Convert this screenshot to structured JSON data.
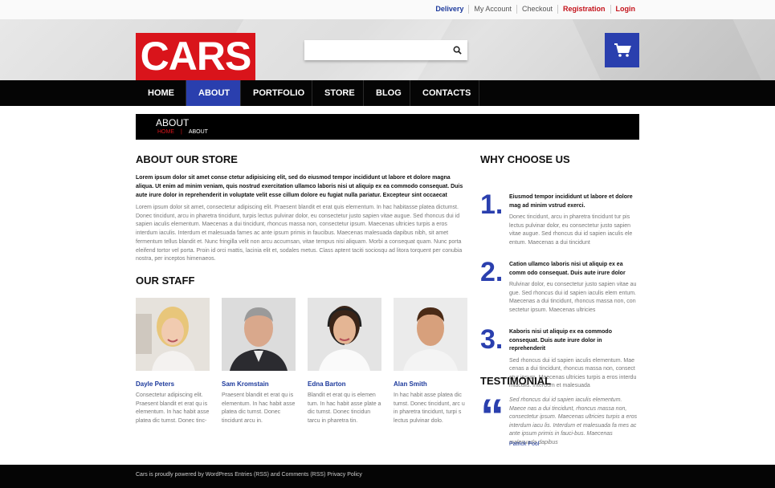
{
  "header": {
    "top_links": [
      "Delivery",
      "My Account",
      "Checkout",
      "Registration",
      "Login"
    ],
    "logo_text": "CARS",
    "search_placeholder": ""
  },
  "nav": {
    "items": [
      "HOME",
      "ABOUT",
      "PORTFOLIO",
      "STORE",
      "BLOG",
      "CONTACTS"
    ],
    "active": "ABOUT"
  },
  "page": {
    "title": "ABOUT",
    "breadcrumb": [
      "HOME",
      "ABOUT"
    ],
    "breadcrumb_separator": "|"
  },
  "about": {
    "heading": "ABOUT OUR STORE",
    "lead": "Lorem ipsum dolor sit amet conse ctetur adipisicing elit, sed do eiusmod tempor incididunt ut labore et dolore magna aliqua. Ut enim ad minim veniam, quis nostrud exercitation ullamco laboris nisi ut aliquip ex ea commodo consequat. Duis aute irure dolor in reprehenderit in voluptate velit esse cillum dolore eu fugiat nulla pariatur. Excepteur sint occaecat",
    "body": "Lorem ipsum dolor sit amet, consectetur adipiscing elit. Praesent blandit et erat quis elementum. In hac habitasse platea dictumst. Donec tincidunt, arcu in pharetra tincidunt, turpis lectus pulvinar dolor, eu consectetur justo sapien vitae augue. Sed rhoncus dui id sapien iaculis elementum. Maecenas a dui tincidunt, rhoncus massa non, consectetur ipsum. Maecenas ultricies turpis a eros interdum iaculis. Interdum et malesuada fames ac ante ipsum primis in faucibus. Maecenas malesuada dapibus nibh, sit amet fermentum tellus blandit et. Nunc fringilla velit non arcu accumsan, vitae tempus nisi aliquam. Morbi a consequat quam. Nunc porta eleifend tortor vel porta. Proin id orci mattis, lacinia elit et, sodales metus. Class aptent taciti sociosqu ad litora torquent per conubia nostra, per inceptos himenaeos."
  },
  "staff": {
    "heading": "OUR STAFF",
    "members": [
      {
        "name": "Dayle Peters",
        "desc": "Consectetur adipiscing elit. Praesent blandit et erat qu is elementum. In hac habit asse platea dic tumst. Donec tinc-"
      },
      {
        "name": "Sam Kromstain",
        "desc": "Praesent blandit et erat qu is elementum. In hac habit asse platea dic tumst. Donec tincidunt arcu in."
      },
      {
        "name": "Edna Barton",
        "desc": "Blandit et erat qu is elemen tum. In hac habit asse plate a dic tumst. Donec tincidun tarcu in pharetra tin."
      },
      {
        "name": "Alan Smith",
        "desc": "In hac habit asse platea dic tumst. Donec tincidunt, arc u in pharetra tincidunt, turpi s lectus pulvinar dolo."
      }
    ]
  },
  "why": {
    "heading": "WHY CHOOSE US",
    "items": [
      {
        "num": "1.",
        "title": "Eiusmod tempor incididunt ut labore et dolore mag ad minim vstrud exerci.",
        "text": "Donec tincidunt, arcu in pharetra tincidunt tur pis lectus pulvinar dolor, eu consectetur justo sapien vitae augue. Sed rhoncus dui id sapien iaculis ele entum. Maecenas a dui tincidunt"
      },
      {
        "num": "2.",
        "title": "Cation ullamco laboris nisi ut aliquip ex ea comm odo consequat. Duis aute irure dolor",
        "text": "Rulvinar dolor, eu consectetur justo sapien vitae au gue. Sed rhoncus dui id sapien iaculis elem entum. Maecenas a dui tincidunt, rhoncus massa non, con sectetur ipsum. Maecenas ultricies"
      },
      {
        "num": "3.",
        "title": "Kaboris nisi ut aliquip ex ea commodo consequat. Duis aute irure dolor in reprehenderit",
        "text": "Sed rhoncus dui id sapien iaculis elementum. Mae cenas a dui tincidunt, rhoncus massa non, consect etur ipsum. Maecenas ultricies turpis a eros interdu miaculis. Interdum et malesuada"
      }
    ]
  },
  "testimonial": {
    "heading": "TESTIMONIAL",
    "text": "Sed rhoncus dui id sapien iaculis elementum. Maece nas a dui tincidunt, rhoncus massa non, consectetur ipsum. Maecenas ultricies turpis a eros interdum iacu lis. Interdum et malesuada fa mes ac ante ipsum primis in fauci-bus. Maecenas malesuada dapibus",
    "author": "Patrick Pool"
  },
  "footer": {
    "text": "Cars is proudly powered by WordPress Entries (RSS) and Comments (RSS) Privacy Policy"
  },
  "colors": {
    "brand_red": "#d9141b",
    "brand_blue": "#2a3fae",
    "link_blue": "#1d3a9c",
    "nav_bg": "#050505"
  },
  "icons": {
    "search": "search-icon",
    "cart": "cart-icon",
    "quote": "quote-icon"
  }
}
